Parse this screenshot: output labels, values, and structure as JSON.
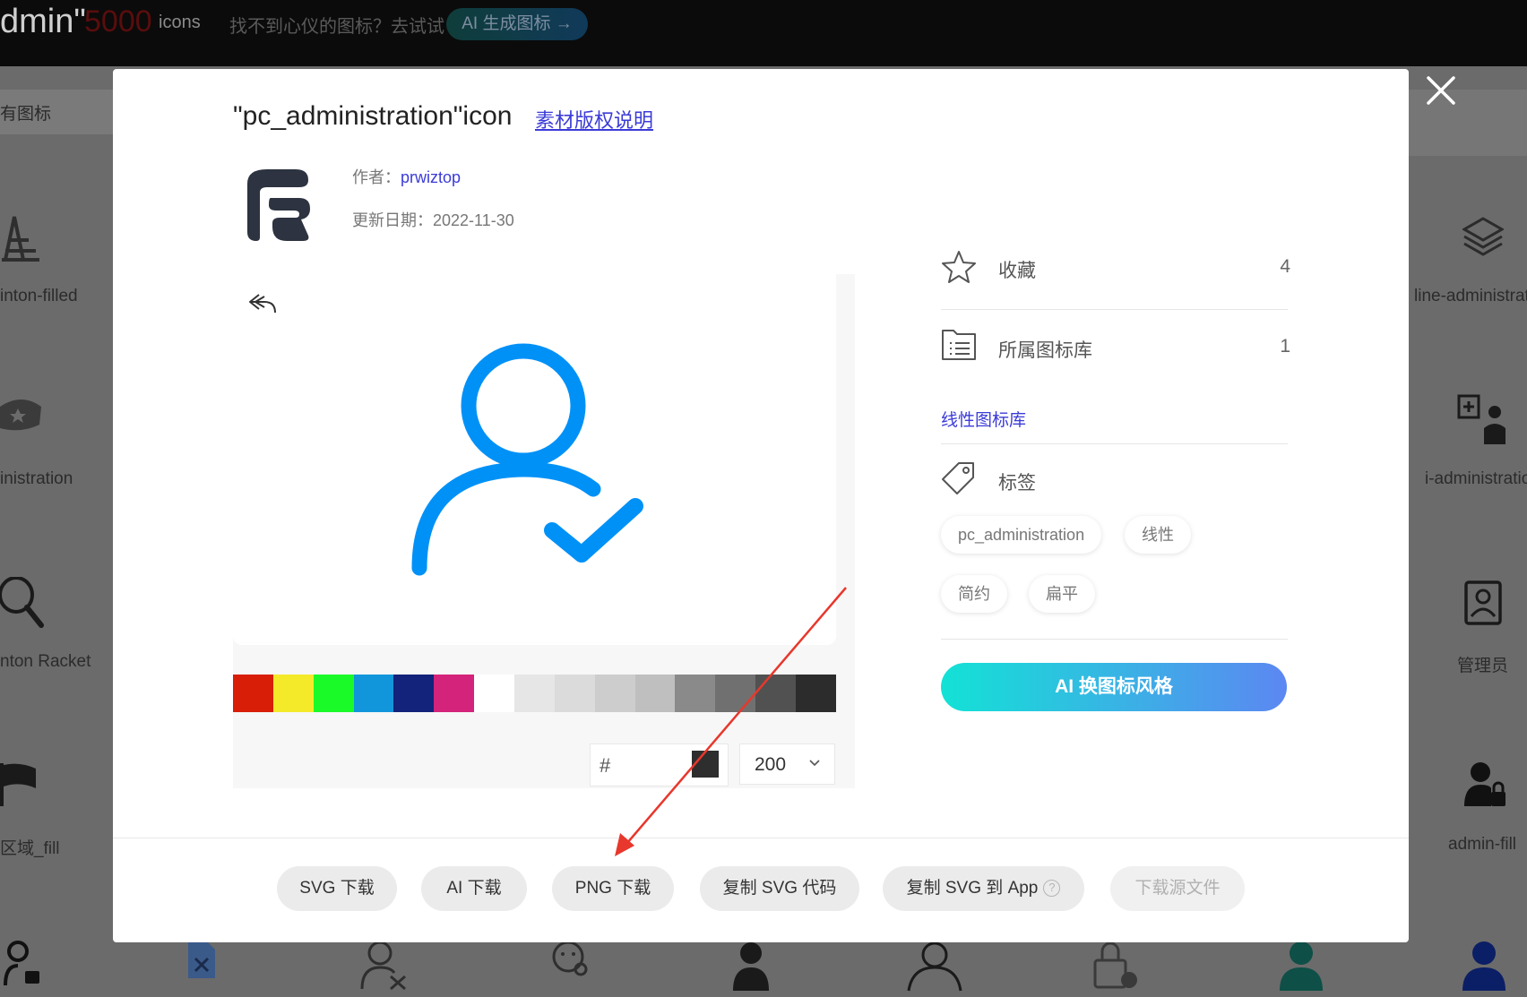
{
  "topbar": {
    "title": "dmin\"",
    "count": "5000",
    "icons_label": "icons",
    "search_hint": "找不到心仪的图标？去试试",
    "ai_button": "AI 生成图标 →"
  },
  "filter": {
    "label": "有图标"
  },
  "background_icons": {
    "left": [
      "inton-filled",
      "inistration",
      "nton Racket",
      "区域_fill"
    ],
    "right": [
      "line-administrat",
      "i-administratio",
      "管理员",
      "admin-fill"
    ]
  },
  "modal": {
    "title": "\"pc_administration\"icon",
    "copyright_link": "素材版权说明",
    "author_label": "作者：",
    "author_name": "prwiztop",
    "date_label": "更新日期：",
    "date_value": "2022-11-30",
    "preview_color": "#0091f7",
    "swatches": [
      "#d81e06",
      "#f4ea2a",
      "#1afa29",
      "#1296db",
      "#13227a",
      "#d4237a",
      "#ffffff",
      "#e6e6e6",
      "#dbdbdb",
      "#cdcdcd",
      "#bfbfbf",
      "#8a8a8a",
      "#707070",
      "#515151",
      "#2c2c2c"
    ],
    "hex_prefix": "#",
    "size_value": "200",
    "favorite_label": "收藏",
    "favorite_count": "4",
    "library_label": "所属图标库",
    "library_count": "1",
    "library_link": "线性图标库",
    "tags_label": "标签",
    "tags": [
      "pc_administration",
      "线性",
      "简约",
      "扁平"
    ],
    "ai_style_button": "AI 换图标风格",
    "buttons": {
      "svg": "SVG 下载",
      "ai": "AI 下载",
      "png": "PNG 下载",
      "copy_svg": "复制 SVG 代码",
      "copy_svg_app": "复制 SVG 到 App",
      "source": "下载源文件"
    },
    "help_glyph": "?"
  }
}
